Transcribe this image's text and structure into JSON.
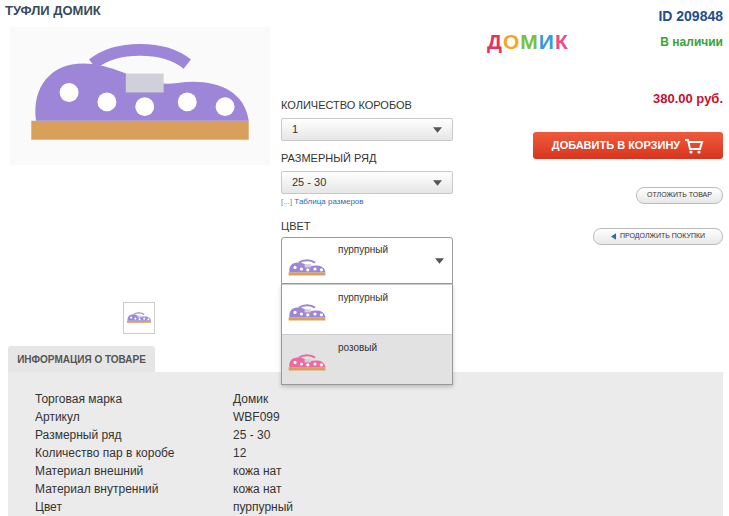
{
  "title": "ТУФЛИ ДОМИК",
  "product_id": "ID 209848",
  "logo": {
    "letters": [
      {
        "char": "Д",
        "color": "#e5325f"
      },
      {
        "char": "О",
        "color": "#f5a623"
      },
      {
        "char": "М",
        "color": "#7cbf3a"
      },
      {
        "char": "И",
        "color": "#3a9ad9"
      },
      {
        "char": "К",
        "color": "#e84c8b"
      }
    ]
  },
  "availability": "В наличии",
  "price": "380.00 руб.",
  "buttons": {
    "add_to_cart": "ДОБАВИТЬ В КОРЗИНУ",
    "postpone": "ОТЛОЖИТЬ ТОВАР",
    "continue": "ПРОДОЛЖИТЬ ПОКУПКИ"
  },
  "options": [
    {
      "label": "КОЛИЧЕСТВО КОРОБОВ",
      "value": "1"
    },
    {
      "label": "РАЗМЕРНЫЙ РЯД",
      "value": "25 - 30"
    }
  ],
  "size_table_link": {
    "prefix": "[...]",
    "label": "Таблица размеров"
  },
  "color_select": {
    "label": "ЦВЕТ",
    "value": "пурпурный",
    "expanded": true,
    "options": [
      {
        "label": "пурпурный",
        "highlighted": false,
        "color": "#9d86d8"
      },
      {
        "label": "розовый",
        "highlighted": true,
        "color": "#ec6aa0"
      }
    ]
  },
  "info_tab": "ИНФОРМАЦИЯ О ТОВАРЕ",
  "info_rows": [
    {
      "label": "Торговая марка",
      "value": "Домик"
    },
    {
      "label": "Артикул",
      "value": "WBF099"
    },
    {
      "label": "Размерный ряд",
      "value": "25 - 30"
    },
    {
      "label": "Количество пар в коробе",
      "value": "12"
    },
    {
      "label": "Материал внешний",
      "value": "кожа нат"
    },
    {
      "label": "Материал внутренний",
      "value": "кожа нат"
    },
    {
      "label": "Цвет",
      "value": "пурпурный"
    }
  ]
}
